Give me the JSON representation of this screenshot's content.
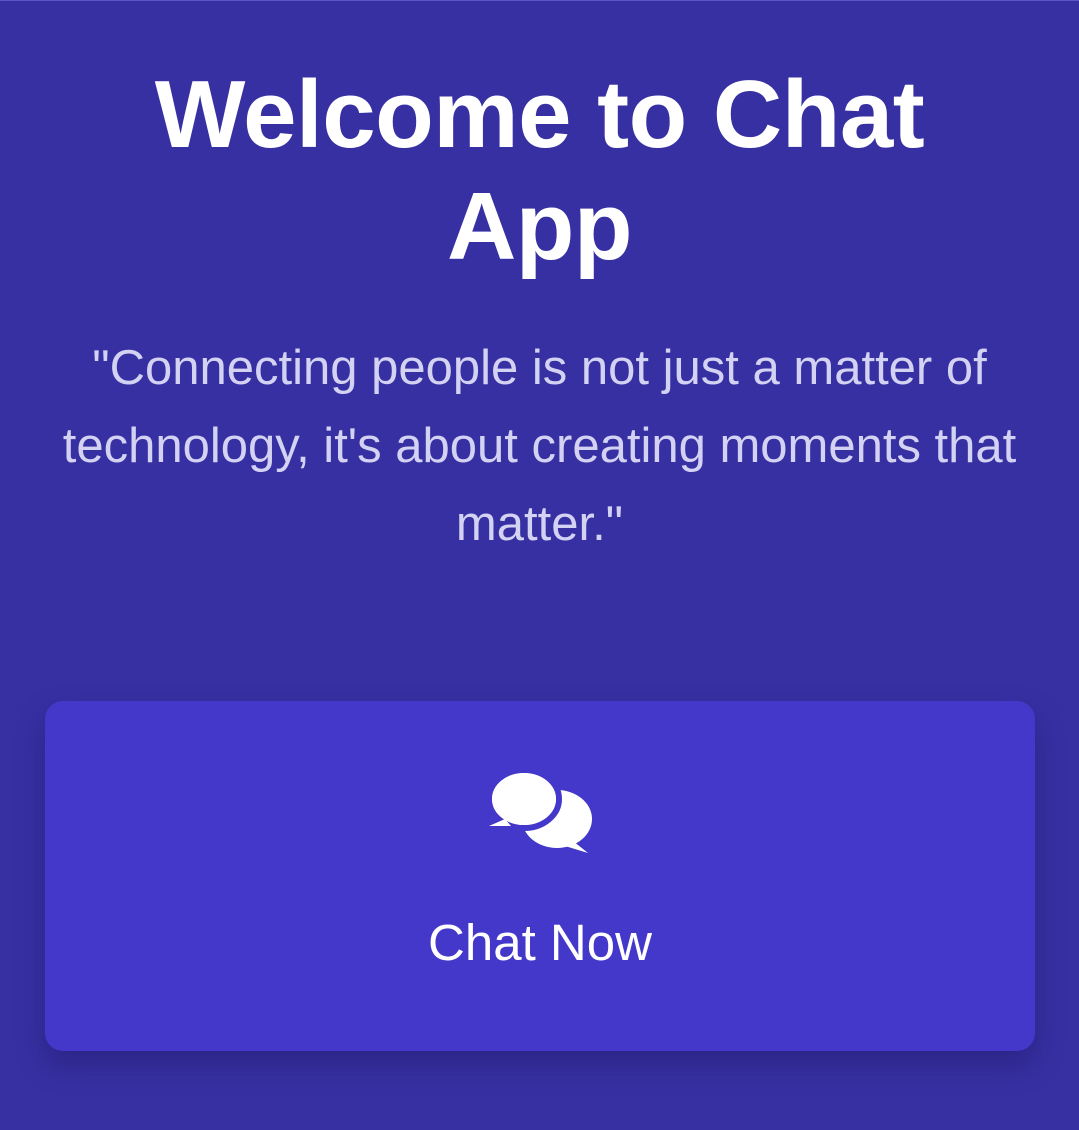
{
  "welcome": {
    "title": "Welcome to Chat App",
    "quote": "\"Connecting people is not just a matter of technology, it's about creating moments that matter.\""
  },
  "chat_card": {
    "icon": "chat-bubbles-icon",
    "label": "Chat Now"
  },
  "colors": {
    "background": "#3730a3",
    "card": "#4338ca",
    "title_text": "#ffffff",
    "quote_text": "#d4d2f3"
  }
}
